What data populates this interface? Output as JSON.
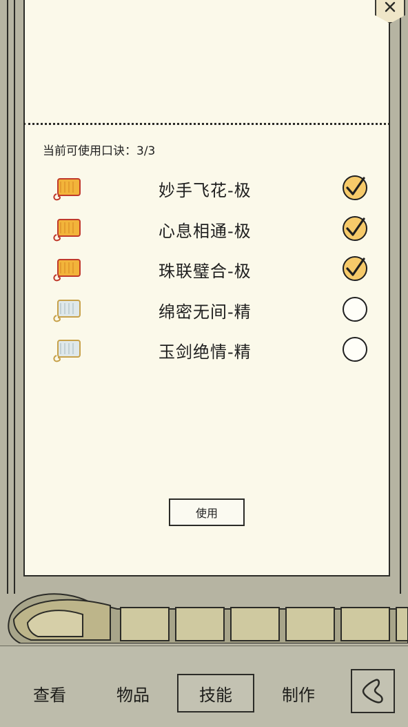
{
  "dialog": {
    "close_label": "×",
    "count_label": "当前可使用口诀：3/3",
    "use_label": "使用"
  },
  "skills": [
    {
      "name": "妙手飞花-极",
      "grade": "极",
      "scroll_color": "gold",
      "checked": true
    },
    {
      "name": "心息相通-极",
      "grade": "极",
      "scroll_color": "gold",
      "checked": true
    },
    {
      "name": "珠联璧合-极",
      "grade": "极",
      "scroll_color": "gold",
      "checked": true
    },
    {
      "name": "绵密无间-精",
      "grade": "精",
      "scroll_color": "pale-blue",
      "checked": false
    },
    {
      "name": "玉剑绝情-精",
      "grade": "精",
      "scroll_color": "pale-blue",
      "checked": false
    }
  ],
  "nav": {
    "items": [
      {
        "label": "查看",
        "active": false
      },
      {
        "label": "物品",
        "active": false
      },
      {
        "label": "技能",
        "active": true
      },
      {
        "label": "制作",
        "active": false
      }
    ],
    "back_icon": "back-arrow-icon"
  },
  "colors": {
    "paper": "#fbf9ea",
    "gold_scroll": "#f2b43a",
    "blue_scroll": "#dfe8ea",
    "background": "#b6b4a2"
  }
}
